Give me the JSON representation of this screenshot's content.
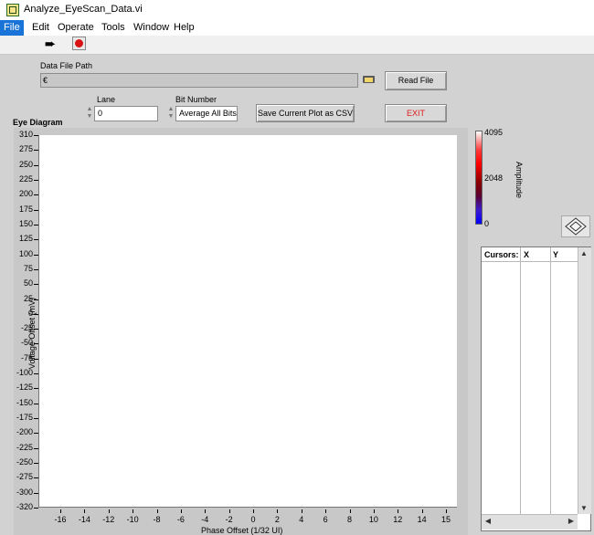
{
  "window": {
    "title": "Analyze_EyeScan_Data.vi"
  },
  "menu": {
    "items": [
      "File",
      "Edit",
      "Operate",
      "Tools",
      "Window",
      "Help"
    ],
    "active": "File"
  },
  "controls": {
    "data_file_path_label": "Data File Path",
    "path_value": "",
    "path_prefix": "€",
    "read_file_label": "Read File",
    "lane_label": "Lane",
    "lane_value": "0",
    "bit_number_label": "Bit Number",
    "bit_number_value": "Average All Bits",
    "save_csv_label": "Save Current Plot as CSV",
    "exit_label": "EXIT"
  },
  "graph": {
    "title": "Eye Diagram",
    "ylabel": "Voltage Offset (mV)",
    "xlabel": "Phase Offset (1/32 UI)",
    "yticks": [
      "310",
      "275",
      "250",
      "225",
      "200",
      "175",
      "150",
      "125",
      "100",
      "75",
      "50",
      "25",
      "0",
      "-25",
      "-50",
      "-75",
      "-100",
      "-125",
      "-150",
      "-175",
      "-200",
      "-225",
      "-250",
      "-275",
      "-300",
      "-320"
    ],
    "xticks": [
      "-16",
      "-14",
      "-12",
      "-10",
      "-8",
      "-6",
      "-4",
      "-2",
      "0",
      "2",
      "4",
      "6",
      "8",
      "10",
      "12",
      "14",
      "15"
    ]
  },
  "colorbar": {
    "label": "Amplitude",
    "ticks": [
      "4095",
      "2048",
      "0"
    ]
  },
  "cursors": {
    "headers": [
      "Cursors:",
      "X",
      "Y"
    ]
  }
}
